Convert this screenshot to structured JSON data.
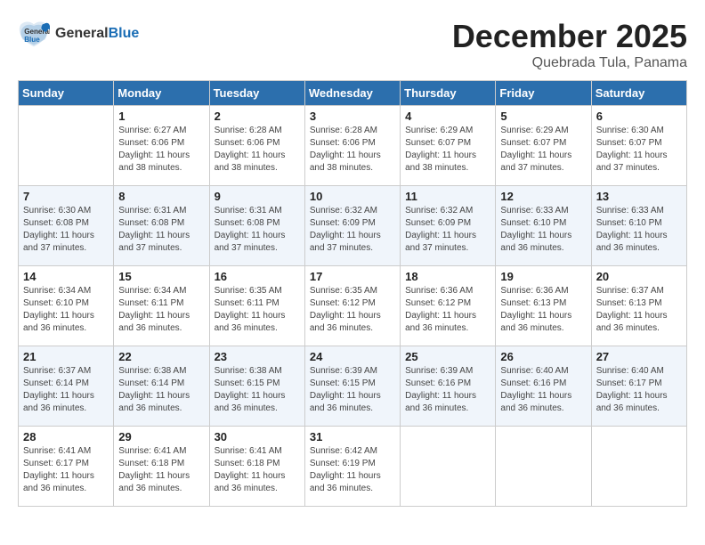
{
  "header": {
    "logo_general": "General",
    "logo_blue": "Blue",
    "month_title": "December 2025",
    "location": "Quebrada Tula, Panama"
  },
  "days_of_week": [
    "Sunday",
    "Monday",
    "Tuesday",
    "Wednesday",
    "Thursday",
    "Friday",
    "Saturday"
  ],
  "weeks": [
    [
      {
        "day": "",
        "sunrise": "",
        "sunset": "",
        "daylight": ""
      },
      {
        "day": "1",
        "sunrise": "Sunrise: 6:27 AM",
        "sunset": "Sunset: 6:06 PM",
        "daylight": "Daylight: 11 hours and 38 minutes."
      },
      {
        "day": "2",
        "sunrise": "Sunrise: 6:28 AM",
        "sunset": "Sunset: 6:06 PM",
        "daylight": "Daylight: 11 hours and 38 minutes."
      },
      {
        "day": "3",
        "sunrise": "Sunrise: 6:28 AM",
        "sunset": "Sunset: 6:06 PM",
        "daylight": "Daylight: 11 hours and 38 minutes."
      },
      {
        "day": "4",
        "sunrise": "Sunrise: 6:29 AM",
        "sunset": "Sunset: 6:07 PM",
        "daylight": "Daylight: 11 hours and 38 minutes."
      },
      {
        "day": "5",
        "sunrise": "Sunrise: 6:29 AM",
        "sunset": "Sunset: 6:07 PM",
        "daylight": "Daylight: 11 hours and 37 minutes."
      },
      {
        "day": "6",
        "sunrise": "Sunrise: 6:30 AM",
        "sunset": "Sunset: 6:07 PM",
        "daylight": "Daylight: 11 hours and 37 minutes."
      }
    ],
    [
      {
        "day": "7",
        "sunrise": "Sunrise: 6:30 AM",
        "sunset": "Sunset: 6:08 PM",
        "daylight": "Daylight: 11 hours and 37 minutes."
      },
      {
        "day": "8",
        "sunrise": "Sunrise: 6:31 AM",
        "sunset": "Sunset: 6:08 PM",
        "daylight": "Daylight: 11 hours and 37 minutes."
      },
      {
        "day": "9",
        "sunrise": "Sunrise: 6:31 AM",
        "sunset": "Sunset: 6:08 PM",
        "daylight": "Daylight: 11 hours and 37 minutes."
      },
      {
        "day": "10",
        "sunrise": "Sunrise: 6:32 AM",
        "sunset": "Sunset: 6:09 PM",
        "daylight": "Daylight: 11 hours and 37 minutes."
      },
      {
        "day": "11",
        "sunrise": "Sunrise: 6:32 AM",
        "sunset": "Sunset: 6:09 PM",
        "daylight": "Daylight: 11 hours and 37 minutes."
      },
      {
        "day": "12",
        "sunrise": "Sunrise: 6:33 AM",
        "sunset": "Sunset: 6:10 PM",
        "daylight": "Daylight: 11 hours and 36 minutes."
      },
      {
        "day": "13",
        "sunrise": "Sunrise: 6:33 AM",
        "sunset": "Sunset: 6:10 PM",
        "daylight": "Daylight: 11 hours and 36 minutes."
      }
    ],
    [
      {
        "day": "14",
        "sunrise": "Sunrise: 6:34 AM",
        "sunset": "Sunset: 6:10 PM",
        "daylight": "Daylight: 11 hours and 36 minutes."
      },
      {
        "day": "15",
        "sunrise": "Sunrise: 6:34 AM",
        "sunset": "Sunset: 6:11 PM",
        "daylight": "Daylight: 11 hours and 36 minutes."
      },
      {
        "day": "16",
        "sunrise": "Sunrise: 6:35 AM",
        "sunset": "Sunset: 6:11 PM",
        "daylight": "Daylight: 11 hours and 36 minutes."
      },
      {
        "day": "17",
        "sunrise": "Sunrise: 6:35 AM",
        "sunset": "Sunset: 6:12 PM",
        "daylight": "Daylight: 11 hours and 36 minutes."
      },
      {
        "day": "18",
        "sunrise": "Sunrise: 6:36 AM",
        "sunset": "Sunset: 6:12 PM",
        "daylight": "Daylight: 11 hours and 36 minutes."
      },
      {
        "day": "19",
        "sunrise": "Sunrise: 6:36 AM",
        "sunset": "Sunset: 6:13 PM",
        "daylight": "Daylight: 11 hours and 36 minutes."
      },
      {
        "day": "20",
        "sunrise": "Sunrise: 6:37 AM",
        "sunset": "Sunset: 6:13 PM",
        "daylight": "Daylight: 11 hours and 36 minutes."
      }
    ],
    [
      {
        "day": "21",
        "sunrise": "Sunrise: 6:37 AM",
        "sunset": "Sunset: 6:14 PM",
        "daylight": "Daylight: 11 hours and 36 minutes."
      },
      {
        "day": "22",
        "sunrise": "Sunrise: 6:38 AM",
        "sunset": "Sunset: 6:14 PM",
        "daylight": "Daylight: 11 hours and 36 minutes."
      },
      {
        "day": "23",
        "sunrise": "Sunrise: 6:38 AM",
        "sunset": "Sunset: 6:15 PM",
        "daylight": "Daylight: 11 hours and 36 minutes."
      },
      {
        "day": "24",
        "sunrise": "Sunrise: 6:39 AM",
        "sunset": "Sunset: 6:15 PM",
        "daylight": "Daylight: 11 hours and 36 minutes."
      },
      {
        "day": "25",
        "sunrise": "Sunrise: 6:39 AM",
        "sunset": "Sunset: 6:16 PM",
        "daylight": "Daylight: 11 hours and 36 minutes."
      },
      {
        "day": "26",
        "sunrise": "Sunrise: 6:40 AM",
        "sunset": "Sunset: 6:16 PM",
        "daylight": "Daylight: 11 hours and 36 minutes."
      },
      {
        "day": "27",
        "sunrise": "Sunrise: 6:40 AM",
        "sunset": "Sunset: 6:17 PM",
        "daylight": "Daylight: 11 hours and 36 minutes."
      }
    ],
    [
      {
        "day": "28",
        "sunrise": "Sunrise: 6:41 AM",
        "sunset": "Sunset: 6:17 PM",
        "daylight": "Daylight: 11 hours and 36 minutes."
      },
      {
        "day": "29",
        "sunrise": "Sunrise: 6:41 AM",
        "sunset": "Sunset: 6:18 PM",
        "daylight": "Daylight: 11 hours and 36 minutes."
      },
      {
        "day": "30",
        "sunrise": "Sunrise: 6:41 AM",
        "sunset": "Sunset: 6:18 PM",
        "daylight": "Daylight: 11 hours and 36 minutes."
      },
      {
        "day": "31",
        "sunrise": "Sunrise: 6:42 AM",
        "sunset": "Sunset: 6:19 PM",
        "daylight": "Daylight: 11 hours and 36 minutes."
      },
      {
        "day": "",
        "sunrise": "",
        "sunset": "",
        "daylight": ""
      },
      {
        "day": "",
        "sunrise": "",
        "sunset": "",
        "daylight": ""
      },
      {
        "day": "",
        "sunrise": "",
        "sunset": "",
        "daylight": ""
      }
    ]
  ]
}
